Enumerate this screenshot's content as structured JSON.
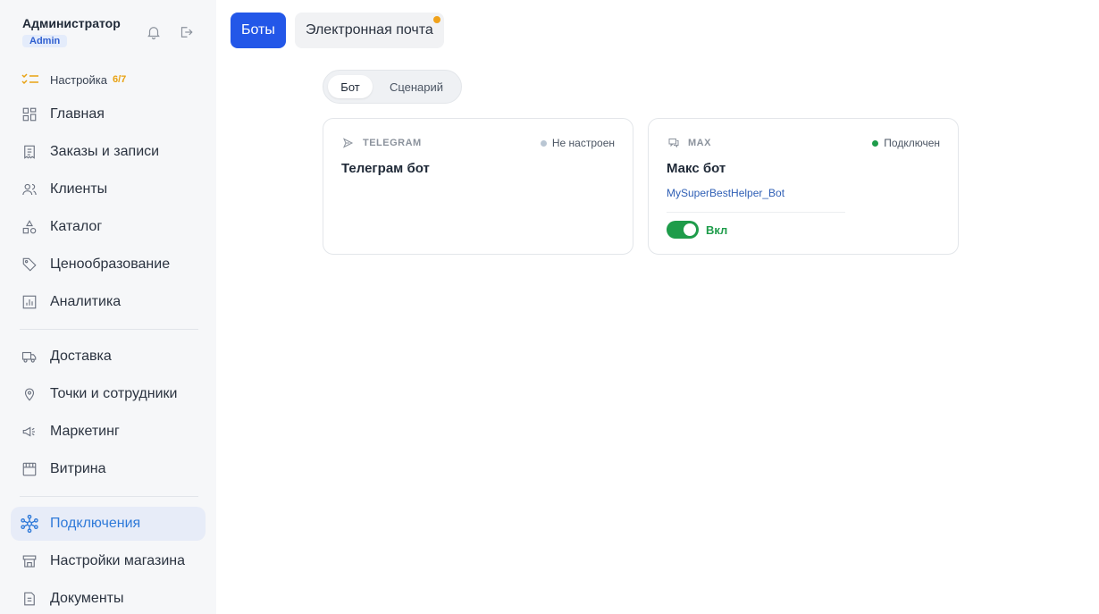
{
  "user": {
    "name": "Администратор",
    "role": "Admin"
  },
  "setup": {
    "label": "Настройка",
    "count": "6/7",
    "accent": "#e8a213"
  },
  "nav": {
    "items": [
      {
        "label": "Главная",
        "icon": "dashboard-icon"
      },
      {
        "label": "Заказы и записи",
        "icon": "receipt-icon"
      },
      {
        "label": "Клиенты",
        "icon": "users-icon"
      },
      {
        "label": "Каталог",
        "icon": "shapes-icon"
      },
      {
        "label": "Ценообразование",
        "icon": "tag-icon"
      },
      {
        "label": "Аналитика",
        "icon": "chart-icon"
      },
      {
        "label": "Доставка",
        "icon": "truck-icon"
      },
      {
        "label": "Точки и сотрудники",
        "icon": "map-pin-icon"
      },
      {
        "label": "Маркетинг",
        "icon": "megaphone-icon"
      },
      {
        "label": "Витрина",
        "icon": "storefront-icon"
      },
      {
        "label": "Подключения",
        "icon": "network-icon",
        "active": true
      },
      {
        "label": "Настройки магазина",
        "icon": "store-settings-icon"
      },
      {
        "label": "Документы",
        "icon": "document-icon"
      }
    ]
  },
  "tabs": {
    "bots": "Боты",
    "email": "Электронная почта"
  },
  "segment": {
    "bot": "Бот",
    "scenario": "Сценарий"
  },
  "cards": {
    "telegram": {
      "platform": "TELEGRAM",
      "status": "Не настроен",
      "status_color": "#b9c6d3",
      "name": "Телеграм бот",
      "icon": "send-icon"
    },
    "max": {
      "platform": "MAX",
      "status": "Подключен",
      "status_color": "#1e9c4a",
      "name": "Макс бот",
      "handle": "MySuperBestHelper_Bot",
      "toggle_label": "Вкл",
      "enabled": true,
      "icon": "chat-icon"
    }
  },
  "colors": {
    "primary": "#2357e8",
    "active_nav": "#2f7ad9",
    "success": "#1e9c4a",
    "warning_dot": "#f0a21b"
  }
}
